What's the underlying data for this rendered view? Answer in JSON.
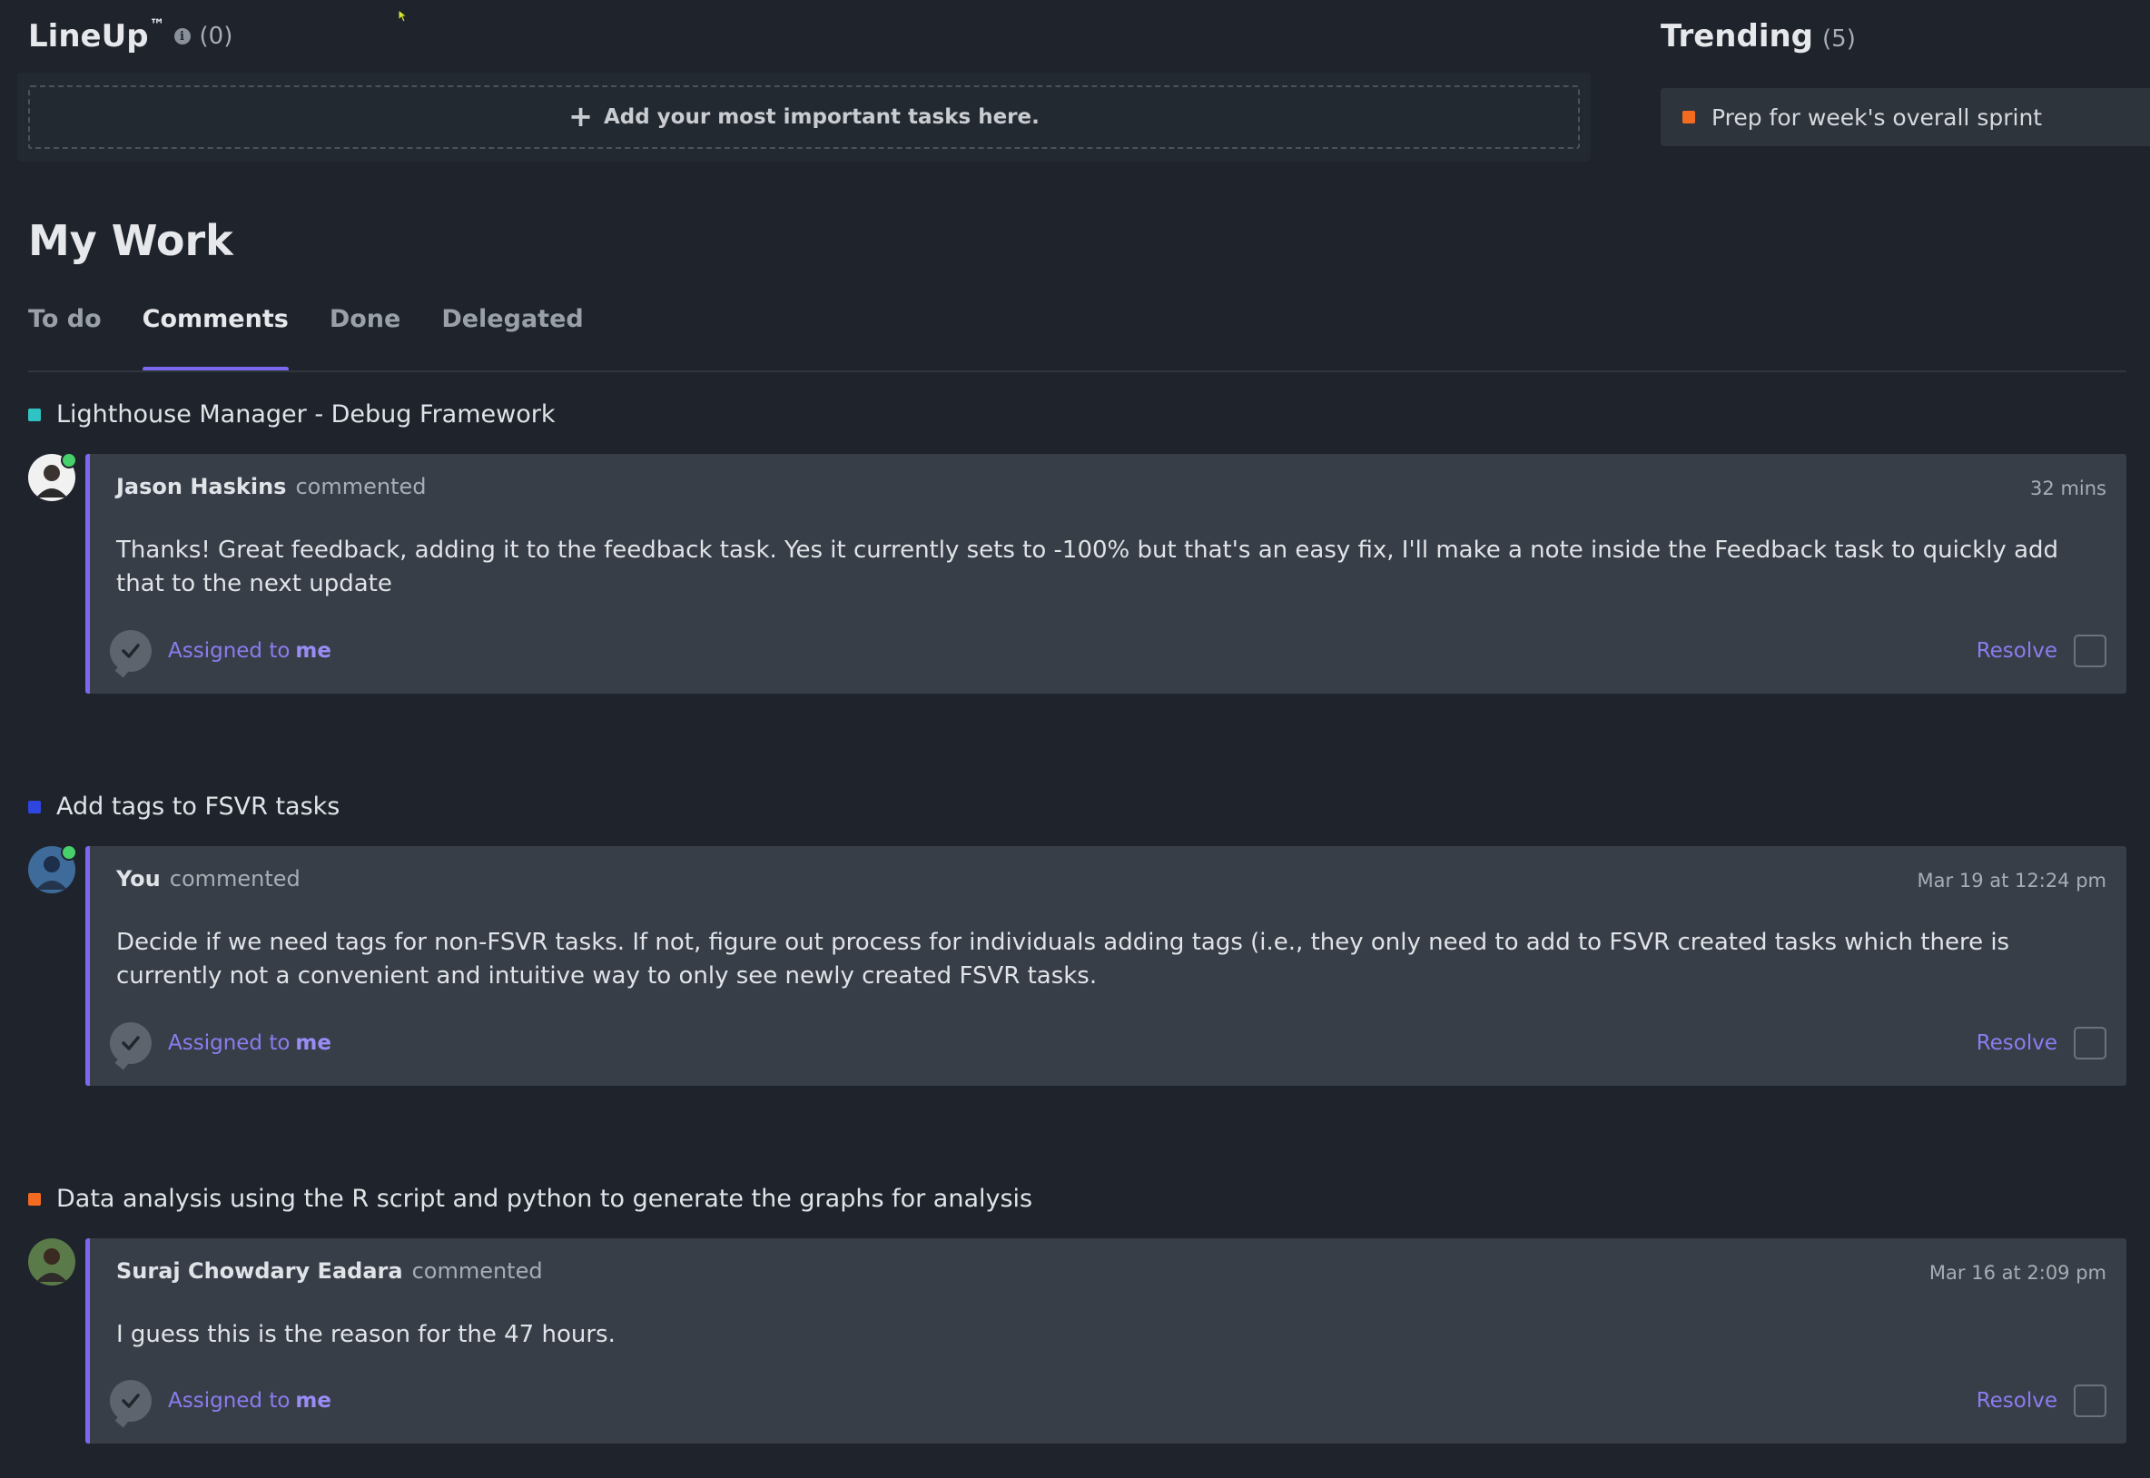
{
  "lineup": {
    "title": "LineUp",
    "tm": "™",
    "info_icon": "info-icon",
    "count": "(0)",
    "add_text": "Add your most important tasks here."
  },
  "trending": {
    "title": "Trending",
    "count": "(5)",
    "items": [
      {
        "label": "Prep for week's overall sprint",
        "color": "#f26b21"
      }
    ]
  },
  "my_work": {
    "title": "My Work",
    "tabs": [
      {
        "label": "To do",
        "active": false
      },
      {
        "label": "Comments",
        "active": true
      },
      {
        "label": "Done",
        "active": false
      },
      {
        "label": "Delegated",
        "active": false
      }
    ]
  },
  "accent_color": "#7b68ee",
  "sections": [
    {
      "task": "Lighthouse Manager - Debug Framework",
      "color": "#2fc3c3",
      "author": "Jason Haskins",
      "verb": "commented",
      "time": "32 mins",
      "body": "Thanks! Great feedback, adding it to the feedback task. Yes it currently sets to -100% but that's an easy fix, I'll make a note inside the Feedback task to quickly add that to the next update",
      "assigned_label": "Assigned to",
      "assigned_to": "me",
      "resolve": "Resolve",
      "online": true
    },
    {
      "task": "Add tags to FSVR tasks",
      "color": "#2f45e0",
      "author": "You",
      "verb": "commented",
      "time": "Mar 19 at 12:24 pm",
      "body": "Decide if we need tags for non-FSVR tasks. If not, figure out process for individuals adding tags (i.e., they only need to add to FSVR created tasks which there is currently not a convenient and intuitive way to only see newly created FSVR tasks.",
      "assigned_label": "Assigned to",
      "assigned_to": "me",
      "resolve": "Resolve",
      "online": true
    },
    {
      "task": "Data analysis using the R script and python to generate the graphs for analysis",
      "color": "#f26b21",
      "author": "Suraj Chowdary Eadara",
      "verb": "commented",
      "time": "Mar 16 at 2:09 pm",
      "body": "I guess this is the reason for the 47 hours.",
      "assigned_label": "Assigned to",
      "assigned_to": "me",
      "resolve": "Resolve",
      "online": false
    }
  ]
}
